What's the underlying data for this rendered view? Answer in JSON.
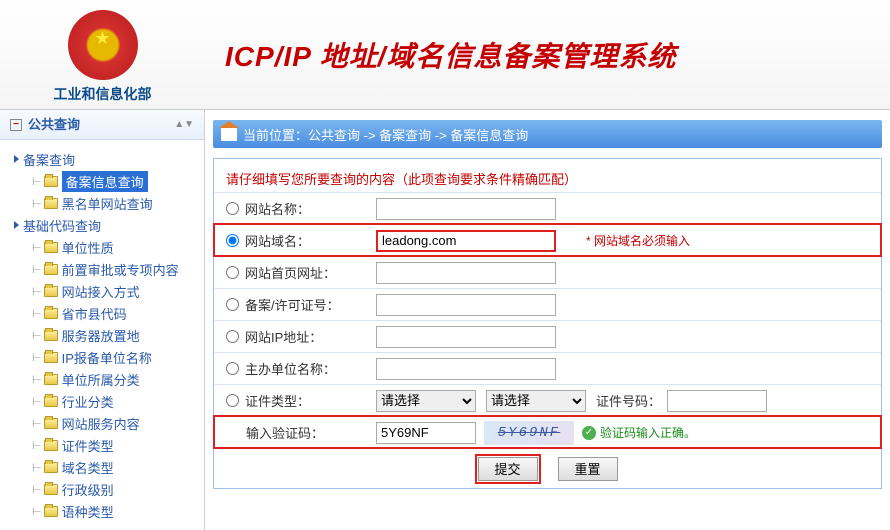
{
  "header": {
    "emblem_text": "工业和信息化部",
    "site_title": "ICP/IP 地址/域名信息备案管理系统"
  },
  "sidebar": {
    "title": "公共查询",
    "groups": [
      {
        "label": "备案查询",
        "children": [
          {
            "label": "备案信息查询",
            "selected": true
          },
          {
            "label": "黑名单网站查询"
          }
        ]
      },
      {
        "label": "基础代码查询",
        "children": [
          {
            "label": "单位性质"
          },
          {
            "label": "前置审批或专项内容"
          },
          {
            "label": "网站接入方式"
          },
          {
            "label": "省市县代码"
          },
          {
            "label": "服务器放置地"
          },
          {
            "label": "IP报备单位名称"
          },
          {
            "label": "单位所属分类"
          },
          {
            "label": "行业分类"
          },
          {
            "label": "网站服务内容"
          },
          {
            "label": "证件类型"
          },
          {
            "label": "域名类型"
          },
          {
            "label": "行政级别"
          },
          {
            "label": "语种类型"
          }
        ]
      }
    ]
  },
  "breadcrumb": {
    "prefix": "当前位置：",
    "items": [
      "公共查询",
      "备案查询",
      "备案信息查询"
    ],
    "sep": "->"
  },
  "form": {
    "hint": "请仔细填写您所要查询的内容（此项查询要求条件精确匹配）",
    "rows": {
      "site_name": {
        "label": "网站名称：",
        "value": ""
      },
      "domain": {
        "label": "网站域名：",
        "value": "leadong.com",
        "note": "* 网站域名必须输入"
      },
      "homepage": {
        "label": "网站首页网址：",
        "value": ""
      },
      "license": {
        "label": "备案/许可证号：",
        "value": ""
      },
      "ip": {
        "label": "网站IP地址：",
        "value": ""
      },
      "org": {
        "label": "主办单位名称：",
        "value": ""
      },
      "cert": {
        "label": "证件类型：",
        "select1": "请选择",
        "select2": "请选择",
        "cert_no_label": "证件号码：",
        "cert_no": ""
      },
      "captcha": {
        "label": "输入验证码：",
        "value": "5Y69NF",
        "img_text": "5Y69NF",
        "ok_text": "验证码输入正确。"
      }
    },
    "buttons": {
      "submit": "提交",
      "reset": "重置"
    }
  }
}
